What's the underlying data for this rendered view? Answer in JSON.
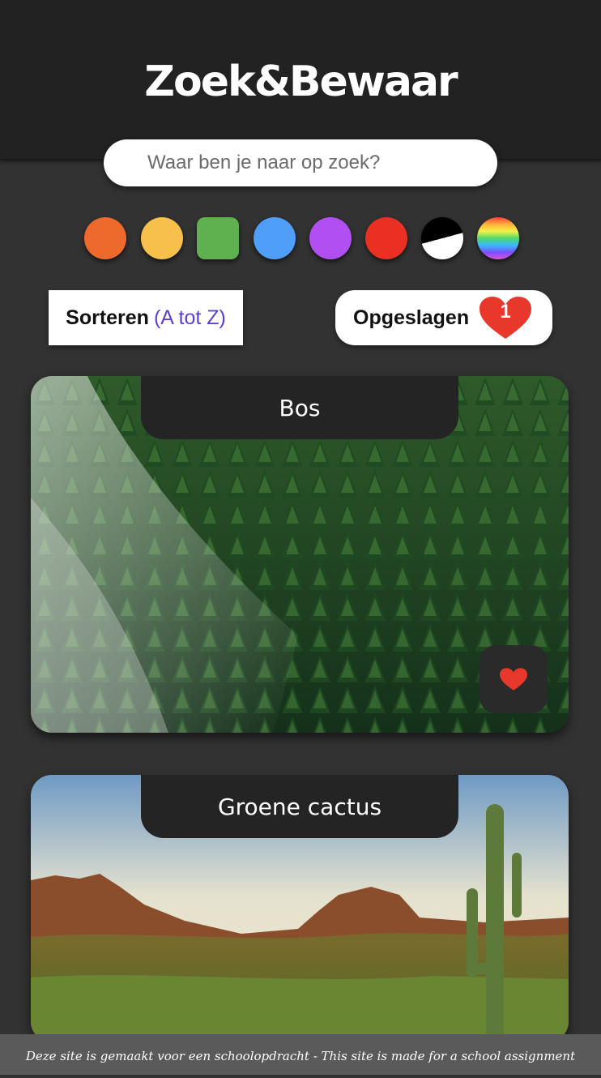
{
  "header": {
    "title": "Zoek&Bewaar"
  },
  "search": {
    "placeholder": "Waar ben je naar op zoek?",
    "value": ""
  },
  "color_filters": [
    {
      "name": "orange",
      "color": "#ee6a2c"
    },
    {
      "name": "yellow",
      "color": "#f6c04a"
    },
    {
      "name": "green",
      "color": "#5fb14f"
    },
    {
      "name": "blue",
      "color": "#4f9ef7"
    },
    {
      "name": "purple",
      "color": "#b14ff2"
    },
    {
      "name": "red",
      "color": "#ea2f23"
    },
    {
      "name": "black-white",
      "colors": [
        "#000000",
        "#ffffff"
      ]
    },
    {
      "name": "rainbow",
      "icon": "rainbow-gradient"
    }
  ],
  "toolbar": {
    "sort_label": "Sorteren",
    "sort_order": "(A tot Z)",
    "saved_label": "Opgeslagen",
    "saved_count": "1",
    "saved_icon": "heart-icon",
    "heart_color": "#e8382c"
  },
  "cards": [
    {
      "title": "Bos",
      "image": "misty-pine-forest",
      "favorite_icon": "heart-icon",
      "favorited": true
    },
    {
      "title": "Groene cactus",
      "image": "desert-saguaro-cactus"
    }
  ],
  "footer": {
    "text": "Deze site is gemaakt voor een schoolopdracht - This site is made for a school assignment"
  }
}
